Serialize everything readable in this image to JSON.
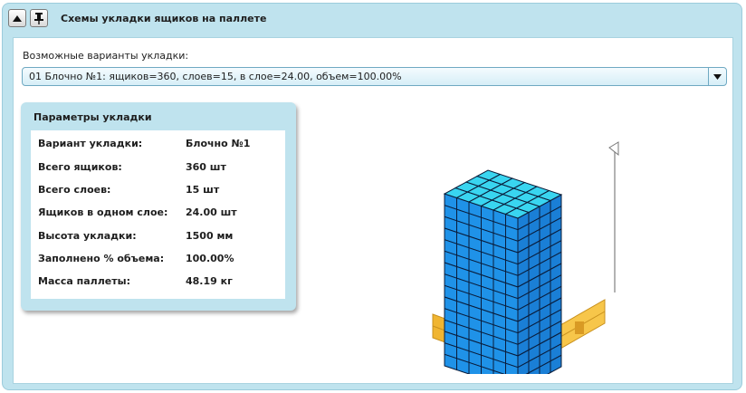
{
  "window": {
    "title": "Схемы укладки ящиков на паллете",
    "buttons": {
      "collapse_icon": "arrow-up-icon",
      "pin_icon": "pin-icon"
    }
  },
  "variants": {
    "label": "Возможные варианты укладки:",
    "selected": "01 Блочно №1: ящиков=360, слоев=15, в слое=24.00, объем=100.00%"
  },
  "params": {
    "title": "Параметры укладки",
    "rows": [
      {
        "label": "Вариант укладки:",
        "value": "Блочно №1"
      },
      {
        "label": "Всего ящиков:",
        "value": "360 шт"
      },
      {
        "label": "Всего слоев:",
        "value": "15 шт"
      },
      {
        "label": "Ящиков в одном слое:",
        "value": "24.00 шт"
      },
      {
        "label": "Высота укладки:",
        "value": "1500 мм"
      },
      {
        "label": "Заполнено % объема:",
        "value": "100.00%"
      },
      {
        "label": "Масса паллеты:",
        "value": "48.19 кг"
      }
    ]
  },
  "colors": {
    "panel_bg": "#bfe3ee",
    "box_top": "#39d5f0",
    "box_side": "#1a7fd6",
    "box_front": "#1f92e8",
    "pallet": "#f7c64a"
  }
}
